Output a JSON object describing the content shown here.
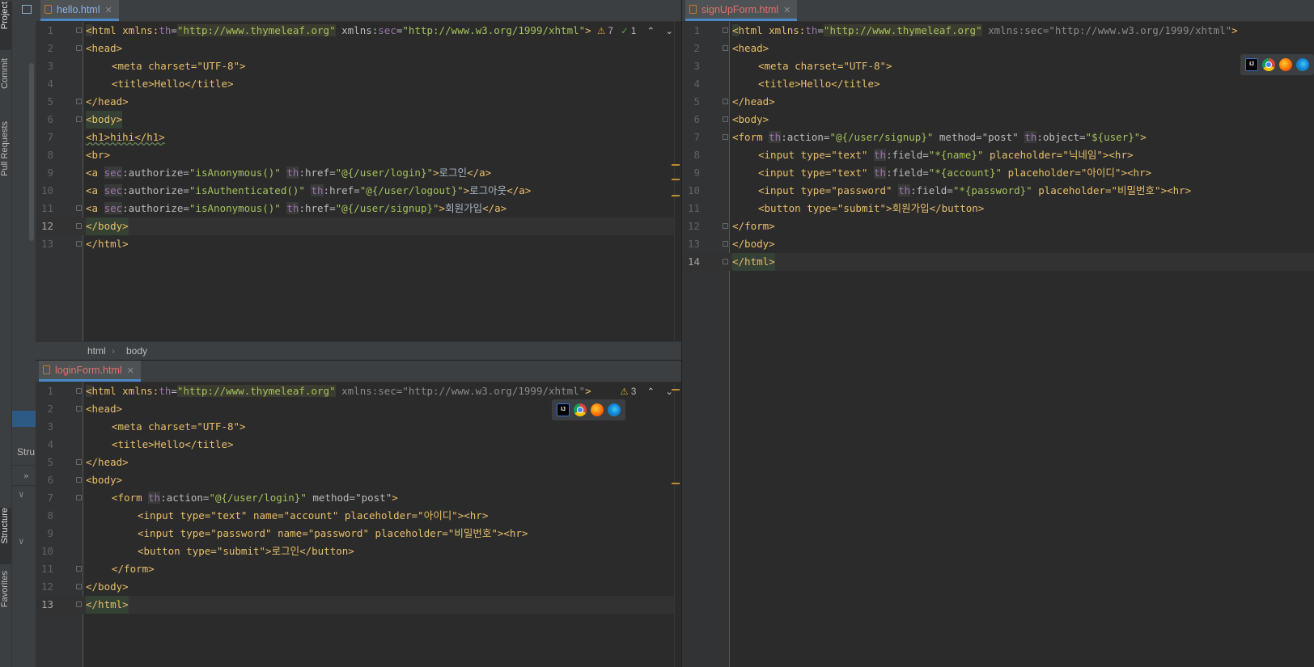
{
  "tool_windows": {
    "project": "Project",
    "commit": "Commit",
    "pull_requests": "Pull Requests",
    "structure": "Structure",
    "favorites": "Favorites",
    "structure_panel_title": "Stru",
    "structure_expand": "»"
  },
  "pane_hello": {
    "tab_label": "hello.html",
    "warnings": "7",
    "typos": "1",
    "breadcrumbs": [
      "html",
      "body"
    ]
  },
  "pane_signup": {
    "tab_label": "signUpForm.html"
  },
  "pane_login": {
    "tab_label": "loginForm.html",
    "warnings": "3"
  },
  "code": {
    "html_open_prefix": "html xmlns:",
    "th": "th",
    "sec": "sec",
    "thymeleaf_url": "\"http://www.thymeleaf.org\"",
    "sec_ns": " xmlns:sec=\"http://www.w3.org/1999/xhtml\"",
    "sec_ns_attr": "xmlns:",
    "sec_ns_eq": "=",
    "sec_url": "\"http://www.w3.org/1999/xhtml\"",
    "head_open": "<head>",
    "meta": "<meta charset=\"UTF-8\">",
    "title": "<title>Hello</title>",
    "head_close": "</head>",
    "body_open": "<body>",
    "body_close": "</body>",
    "html_close": "</html>",
    "h1": "<h1>hihi</h1>",
    "br": "<br>",
    "a_open": "<a ",
    "authorize": ":authorize=",
    "is_anonymous": "\"isAnonymous()\"",
    "is_authenticated": "\"isAuthenticated()\"",
    "href": ":href=",
    "login_url": "\"@{/user/login}\"",
    "logout_url": "\"@{/user/logout}\"",
    "signup_url": "\"@{/user/signup}\"",
    "login_text": "로그인",
    "logout_text": "로그아웃",
    "signup_text": "회원가입",
    "a_close": "</a>",
    "form_open": "<form ",
    "action": ":action=",
    "method_post": " method=\"post\"",
    "object": ":object=",
    "user_obj": "\"${user}\"",
    "form_end_tag": ">",
    "form_close": "</form>",
    "input_text": "<input type=\"text\" ",
    "input_password": "<input type=\"password\" ",
    "field": ":field=",
    "field_name": "\"*{name}\"",
    "field_account": "\"*{account}\"",
    "field_password": "\"*{password}\"",
    "ph_nickname": " placeholder=\"닉네임\"><hr>",
    "ph_id": " placeholder=\"아이디\"><hr>",
    "ph_pw": " placeholder=\"비밀번호\"><hr>",
    "signup_button": "<button type=\"submit\">회원가입</button>",
    "login_input_account": "<input type=\"text\" name=\"account\" placeholder=\"아이디\"><hr>",
    "login_input_password": "<input type=\"password\" name=\"password\" placeholder=\"비밀번호\"><hr>",
    "login_button": "<button type=\"submit\">로그인</button>"
  },
  "line_numbers": [
    "1",
    "2",
    "3",
    "4",
    "5",
    "6",
    "7",
    "8",
    "9",
    "10",
    "11",
    "12",
    "13",
    "14"
  ],
  "browser_icons": [
    "IJ"
  ],
  "colors": {
    "editor_bg": "#2b2b2b",
    "gutter_bg": "#313335",
    "tag": "#e8bf6a",
    "attr_value": "#a5c25c",
    "namespace": "#9876aa",
    "tab_active_text": "#8bb0e8",
    "tab_modified_text": "#e26f6f"
  }
}
